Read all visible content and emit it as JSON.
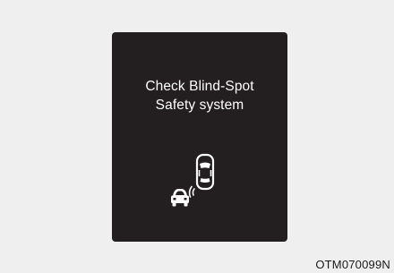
{
  "display": {
    "line1": "Check Blind-Spot",
    "line2": "Safety system",
    "icon": "blind-spot-warning-icon"
  },
  "caption": "OTM070099N",
  "colors": {
    "background": "#efefef",
    "panel": "#231f20",
    "text": "#ffffff"
  }
}
